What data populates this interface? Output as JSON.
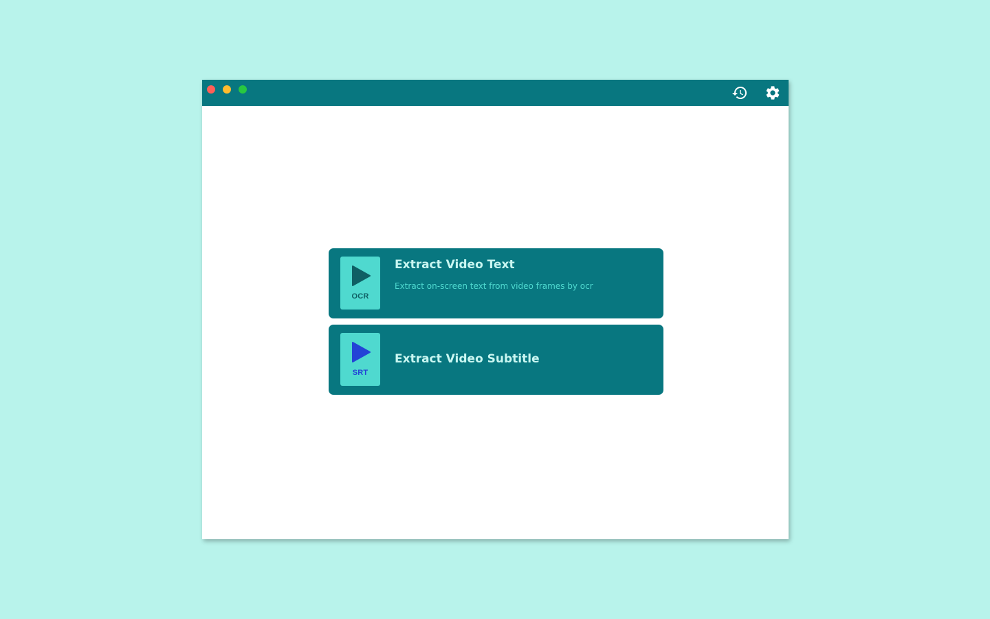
{
  "colors": {
    "desktop_background": "#b8f3eb",
    "titlebar": "#087780",
    "card_background": "#087780",
    "file_icon": "#4fd9cf",
    "ocr_accent": "#0f5f64",
    "srt_accent": "#2344d6",
    "card_title": "#c9f6f1",
    "card_description": "#4fd9cf",
    "traffic_close": "#ff5f57",
    "traffic_minimize": "#febc2e",
    "traffic_maximize": "#28c840"
  },
  "titlebar": {
    "icons": [
      "history-icon",
      "gear-icon"
    ]
  },
  "cards": [
    {
      "icon": "play-icon",
      "file_label": "OCR",
      "title": "Extract Video Text",
      "description": "Extract on-screen text from video frames by ocr"
    },
    {
      "icon": "play-icon",
      "file_label": "SRT",
      "title": "Extract Video Subtitle"
    }
  ]
}
